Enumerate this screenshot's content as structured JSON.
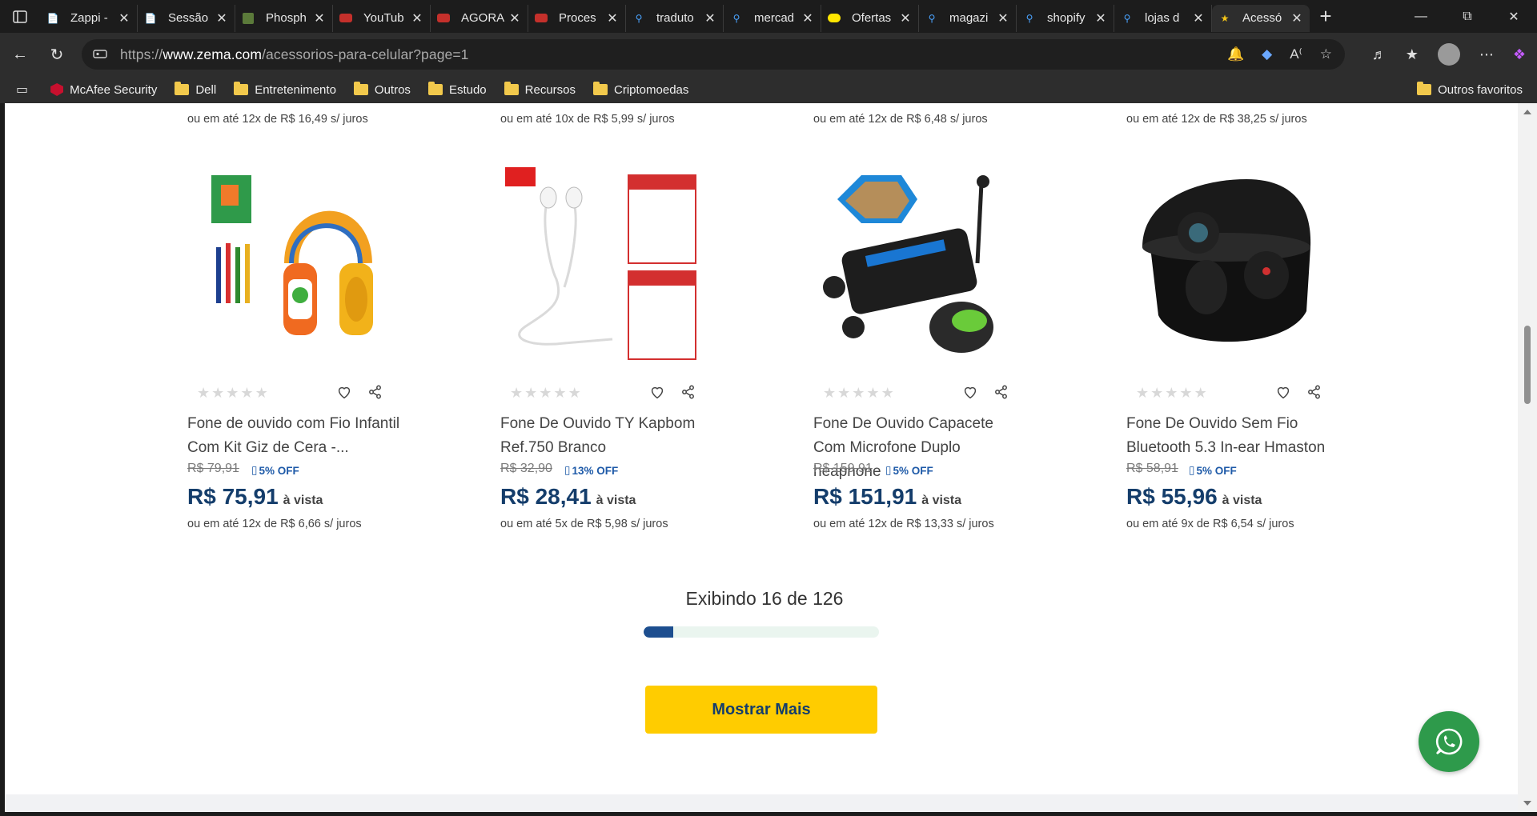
{
  "browser": {
    "tabs": [
      {
        "title": "Zappi -",
        "icon": "page-icon"
      },
      {
        "title": "Sessão",
        "icon": "page-icon"
      },
      {
        "title": "Phosph",
        "icon": "phosphor-icon"
      },
      {
        "title": "YouTub",
        "icon": "youtube-icon"
      },
      {
        "title": "AGORA",
        "icon": "youtube-icon"
      },
      {
        "title": "Proces",
        "icon": "youtube-icon"
      },
      {
        "title": "traduto",
        "icon": "search-icon"
      },
      {
        "title": "mercad",
        "icon": "search-icon"
      },
      {
        "title": "Ofertas",
        "icon": "mercado-icon"
      },
      {
        "title": "magazi",
        "icon": "search-icon"
      },
      {
        "title": "shopify",
        "icon": "search-icon"
      },
      {
        "title": "lojas d",
        "icon": "search-icon"
      },
      {
        "title": "Acessó",
        "icon": "star-icon",
        "active": true
      }
    ],
    "url_prefix": "https://",
    "url_domain": "www.zema.com",
    "url_path": "/acessorios-para-celular?page=1",
    "bookmarks": [
      {
        "label": "McAfee Security",
        "icon": "mcafee-icon"
      },
      {
        "label": "Dell",
        "icon": "folder-icon"
      },
      {
        "label": "Entretenimento",
        "icon": "folder-icon"
      },
      {
        "label": "Outros",
        "icon": "folder-icon"
      },
      {
        "label": "Estudo",
        "icon": "folder-icon"
      },
      {
        "label": "Recursos",
        "icon": "folder-icon"
      },
      {
        "label": "Criptomoedas",
        "icon": "folder-icon"
      }
    ],
    "other_favorites": "Outros favoritos"
  },
  "top_installments": [
    "ou em até 12x de R$ 16,49 s/ juros",
    "ou em até 10x de R$ 5,99 s/ juros",
    "ou em até 12x de R$ 6,48 s/ juros",
    "ou em até 12x de R$ 38,25 s/ juros"
  ],
  "products": [
    {
      "name": "Fone de ouvido com Fio Infantil Com Kit Giz de Cera -...",
      "old_price": "R$ 79,91",
      "discount": "5% OFF",
      "price": "R$ 75,91",
      "price_suffix": "à vista",
      "installments": "ou em até 12x de R$ 6,66 s/ juros",
      "rating": 0
    },
    {
      "name": "Fone De Ouvido TY Kapbom Ref.750 Branco",
      "old_price": "R$ 32,90",
      "discount": "13% OFF",
      "price": "R$ 28,41",
      "price_suffix": "à vista",
      "installments": "ou em até 5x de R$ 5,98 s/ juros",
      "rating": 0
    },
    {
      "name": "Fone De Ouvido Capacete Com Microfone Duplo heaphone",
      "old_price": "R$ 159,91",
      "discount": "5% OFF",
      "price": "R$ 151,91",
      "price_suffix": "à vista",
      "installments": "ou em até 12x de R$ 13,33 s/ juros",
      "rating": 0
    },
    {
      "name": "Fone De Ouvido Sem Fio Bluetooth 5.3 In-ear Hmaston",
      "old_price": "R$ 58,91",
      "discount": "5% OFF",
      "price": "R$ 55,96",
      "price_suffix": "à vista",
      "installments": "ou em até 9x de R$ 6,54 s/ juros",
      "rating": 0
    }
  ],
  "pagination": {
    "text": "Exibindo 16 de 126",
    "shown": 16,
    "total": 126,
    "progress": 0.127
  },
  "show_more_label": "Mostrar Mais",
  "colors": {
    "brand_blue": "#143d6b",
    "accent_yellow": "#ffcc00",
    "whatsapp_green": "#2e9a4b"
  }
}
